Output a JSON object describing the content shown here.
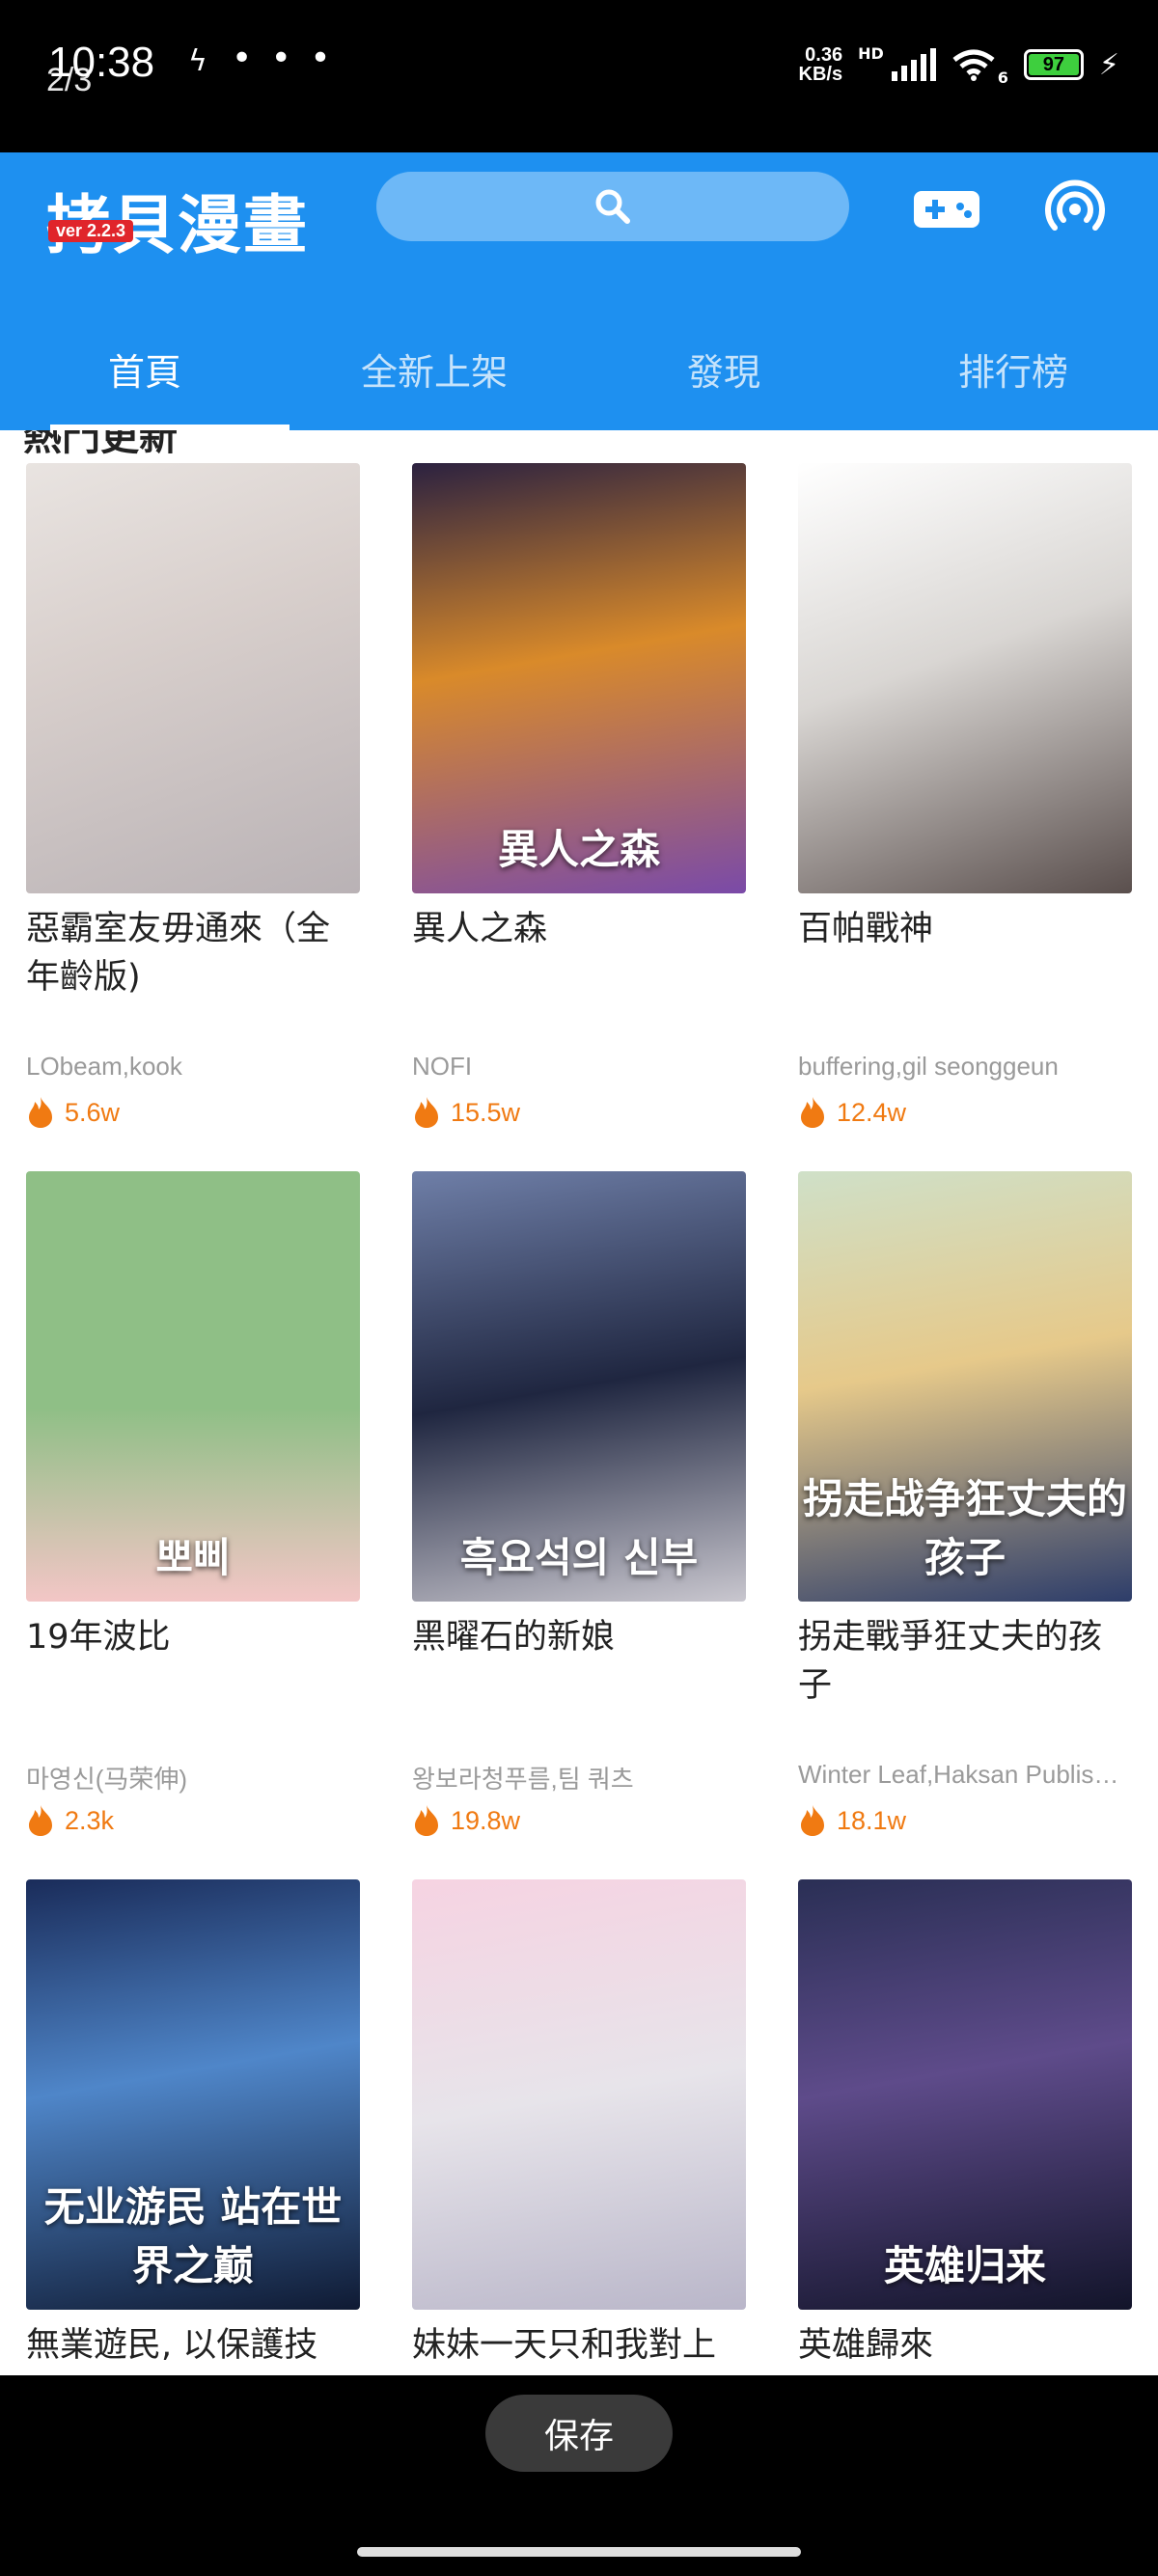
{
  "status_bar": {
    "time": "10:38",
    "page_indicator": "2/3",
    "usb_symbol": "ϟ",
    "more_dots": "• • •",
    "net_speed_value": "0.36",
    "net_speed_unit": "KB/s",
    "net_type": "HD",
    "wifi_label": "6",
    "battery_level": "97"
  },
  "header": {
    "app_name": "拷貝漫畫",
    "version": "ver 2.2.3",
    "search_placeholder": "",
    "accent_color": "#1e90f0"
  },
  "tabs": [
    {
      "label": "首頁",
      "active": true
    },
    {
      "label": "全新上架",
      "active": false
    },
    {
      "label": "發現",
      "active": false
    },
    {
      "label": "排行榜",
      "active": false
    }
  ],
  "section_title_peek": "熱門更新",
  "comics": [
    {
      "title": "惡霸室友毋通來（全年齡版)",
      "author": "LObeam,kook",
      "heat": "5.6w",
      "cover_text": "",
      "cover_bg": "linear-gradient(160deg,#e9e4e1 0%,#d8cfcc 40%,#b9b2b5 100%)"
    },
    {
      "title": "異人之森",
      "author": "NOFI",
      "heat": "15.5w",
      "cover_text": "異人之森",
      "cover_bg": "linear-gradient(170deg,#2b2140 0%,#d98a2a 45%,#7a4aa8 100%)"
    },
    {
      "title": "百帕戰神",
      "author": "buffering,gil seonggeun",
      "heat": "12.4w",
      "cover_text": "",
      "cover_bg": "linear-gradient(160deg,#ffffff 0%,#d9d6d3 45%,#5a4f4d 100%)"
    },
    {
      "title": "19年波比",
      "author": "마영신(马荣伸)",
      "heat": "2.3k",
      "cover_text": "뽀삐",
      "cover_bg": "linear-gradient(180deg,#8fbf86 0%,#8fbf86 55%,#f3c6c6 100%)"
    },
    {
      "title": "黑曜石的新娘",
      "author": "왕보라청푸름,팀 쿼츠",
      "heat": "19.8w",
      "cover_text": "흑요석의 신부",
      "cover_bg": "linear-gradient(170deg,#6f7fa8 0%,#1f2640 50%,#c9c7cf 100%)"
    },
    {
      "title": "拐走戰爭狂丈夫的孩子",
      "author": "Winter Leaf,Haksan Publishing",
      "heat": "18.1w",
      "cover_text": "拐走战争狂丈夫的孩子",
      "cover_bg": "linear-gradient(170deg,#cfe0c8 0%,#e6c98a 45%,#2d3d6a 100%)"
    },
    {
      "title": "無業遊民, 以保護技",
      "author": "",
      "heat": "",
      "cover_text": "无业游民 站在世界之巅",
      "cover_bg": "linear-gradient(170deg,#1a2c5a 0%,#4f86c9 45%,#0f1a33 100%)"
    },
    {
      "title": "妹妹一天只和我對上",
      "author": "",
      "heat": "",
      "cover_text": "",
      "cover_bg": "linear-gradient(170deg,#f6d3e2 0%,#e7e4ea 50%,#b9b6c9 100%)"
    },
    {
      "title": "英雄歸來",
      "author": "",
      "heat": "",
      "cover_text": "英雄归来",
      "cover_bg": "linear-gradient(170deg,#2a2f55 0%,#5e4b8a 45%,#12142a 100%)"
    }
  ],
  "bottom": {
    "save_label": "保存"
  }
}
